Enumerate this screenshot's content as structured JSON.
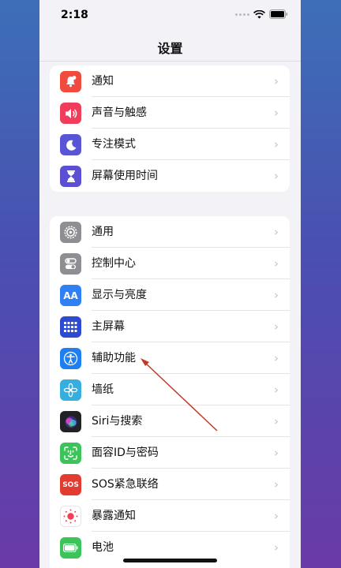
{
  "status_bar": {
    "time": "2:18"
  },
  "nav": {
    "title": "设置"
  },
  "groups": [
    {
      "items": [
        {
          "label": "通知",
          "icon": "bell-badge-icon",
          "color": "#f04b3e"
        },
        {
          "label": "声音与触感",
          "icon": "speaker-icon",
          "color": "#ef3d5b"
        },
        {
          "label": "专注模式",
          "icon": "moon-icon",
          "color": "#5856d6"
        },
        {
          "label": "屏幕使用时间",
          "icon": "hourglass-icon",
          "color": "#5b4fd3"
        }
      ]
    },
    {
      "items": [
        {
          "label": "通用",
          "icon": "gear-icon",
          "color": "#8e8e93"
        },
        {
          "label": "控制中心",
          "icon": "toggles-icon",
          "color": "#8e8e93"
        },
        {
          "label": "显示与亮度",
          "icon": "aa-text-icon",
          "color": "#2f7ff5",
          "icon_text": "AA"
        },
        {
          "label": "主屏幕",
          "icon": "grid-icon",
          "color": "#2d4bd0"
        },
        {
          "label": "辅助功能",
          "icon": "accessibility-icon",
          "color": "#1f7ff0"
        },
        {
          "label": "墙纸",
          "icon": "flower-icon",
          "color": "#36aee0"
        },
        {
          "label": "Siri与搜索",
          "icon": "siri-icon",
          "color": "#222226"
        },
        {
          "label": "面容ID与密码",
          "icon": "face-id-icon",
          "color": "#3cc45a"
        },
        {
          "label": "SOS紧急联络",
          "icon": "sos-icon",
          "color": "#e23b30",
          "icon_text": "SOS"
        },
        {
          "label": "暴露通知",
          "icon": "exposure-icon",
          "color": "#ffffff"
        },
        {
          "label": "电池",
          "icon": "battery-icon",
          "color": "#3cc45a"
        }
      ]
    }
  ],
  "chevron": "›"
}
